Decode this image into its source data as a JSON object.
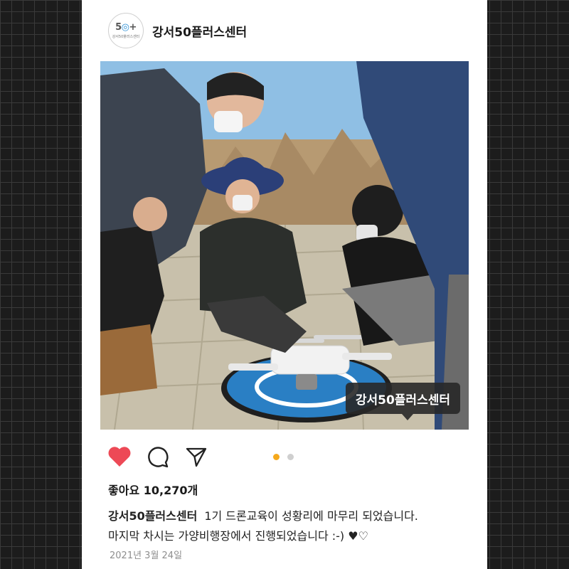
{
  "post": {
    "account_name": "강서50플러스센터",
    "avatar": {
      "logo_text": "50+",
      "logo_subtext": "강서50플러스센터"
    },
    "photo": {
      "description_icon": "photo",
      "tag_label": "강서50플러스센터"
    },
    "actions": {
      "like_icon": "heart-filled-icon",
      "comment_icon": "comment-icon",
      "share_icon": "send-icon",
      "like_color": "#ed4956"
    },
    "carousel": {
      "count": 2,
      "active_index": 0,
      "active_color": "#f5a91c"
    },
    "likes_text": "좋아요 10,270개",
    "caption": {
      "username": "강서50플러스센터",
      "line1": "1기 드론교육이 성황리에 마무리 되었습니다.",
      "line2": "마지막 차시는 가양비행장에서 진행되었습니다 :-) ♥♡"
    },
    "date": "2021년 3월 24일"
  }
}
